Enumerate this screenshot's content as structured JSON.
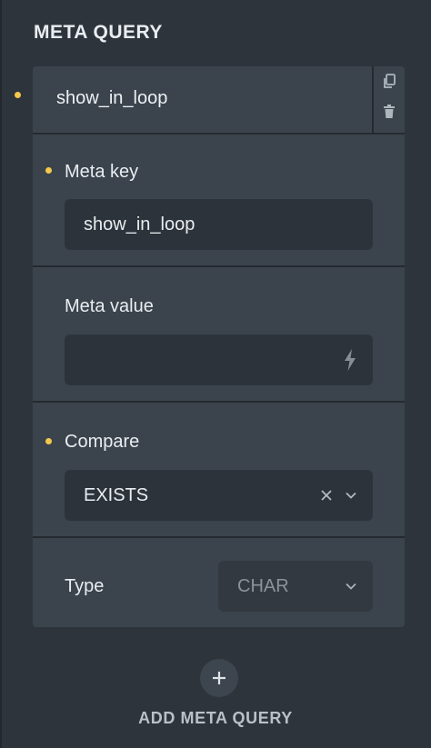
{
  "panel": {
    "title": "META QUERY"
  },
  "item": {
    "title": "show_in_loop"
  },
  "meta_key": {
    "label": "Meta key",
    "value": "show_in_loop"
  },
  "meta_value": {
    "label": "Meta value",
    "value": "",
    "icon": "bolt-icon"
  },
  "compare": {
    "label": "Compare",
    "value": "EXISTS"
  },
  "type": {
    "label": "Type",
    "value": "CHAR"
  },
  "footer": {
    "add_label": "ADD META QUERY"
  },
  "colors": {
    "accent": "#f4c84b",
    "background": "#2e343c",
    "card": "#3b444d",
    "field": "#2d333a"
  }
}
